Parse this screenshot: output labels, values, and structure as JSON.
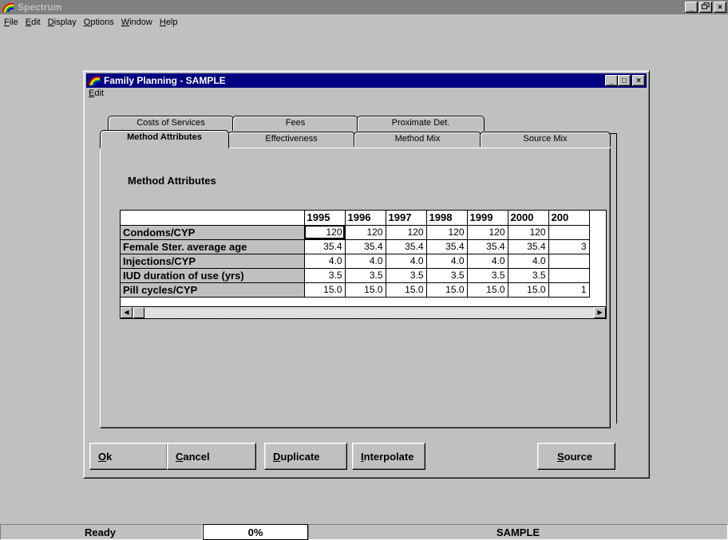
{
  "app": {
    "title": "Spectrum",
    "menu": [
      {
        "label": "File",
        "key": "F"
      },
      {
        "label": "Edit",
        "key": "E"
      },
      {
        "label": "Display",
        "key": "D"
      },
      {
        "label": "Options",
        "key": "O"
      },
      {
        "label": "Window",
        "key": "W"
      },
      {
        "label": "Help",
        "key": "H"
      }
    ],
    "controls": {
      "minimize": "_",
      "restore": "ř",
      "close": "×"
    }
  },
  "child": {
    "title": "Family Planning - SAMPLE",
    "menu": [
      "Edit"
    ],
    "controls": {
      "minimize": "_",
      "maximize": "□",
      "close": "×"
    }
  },
  "tabs": {
    "back_row": [
      "Costs of Services",
      "Fees",
      "Proximate Det."
    ],
    "front_row": [
      "Method Attributes",
      "Effectiveness",
      "Method Mix",
      "Source Mix"
    ],
    "active": "Method Attributes"
  },
  "panel": {
    "section_title": "Method Attributes",
    "grid": {
      "columns": [
        "1995",
        "1996",
        "1997",
        "1998",
        "1999",
        "2000",
        "200"
      ],
      "rows": [
        {
          "label": "Condoms/CYP",
          "values": [
            "120",
            "120",
            "120",
            "120",
            "120",
            "120",
            ""
          ]
        },
        {
          "label": "Female Ster. average age",
          "values": [
            "35.4",
            "35.4",
            "35.4",
            "35.4",
            "35.4",
            "35.4",
            "3"
          ]
        },
        {
          "label": "Injections/CYP",
          "values": [
            "4.0",
            "4.0",
            "4.0",
            "4.0",
            "4.0",
            "4.0",
            ""
          ]
        },
        {
          "label": "IUD duration of use (yrs)",
          "values": [
            "3.5",
            "3.5",
            "3.5",
            "3.5",
            "3.5",
            "3.5",
            ""
          ]
        },
        {
          "label": "Pill cycles/CYP",
          "values": [
            "15.0",
            "15.0",
            "15.0",
            "15.0",
            "15.0",
            "15.0",
            "1"
          ]
        }
      ],
      "selected_cell": "Condoms/CYP 1995"
    }
  },
  "buttons": {
    "ok": {
      "label": "Ok",
      "key": "O",
      "rest": "k"
    },
    "cancel": {
      "label": "Cancel",
      "key": "C",
      "rest": "ancel"
    },
    "duplicate": {
      "label": "Duplicate",
      "key": "D",
      "rest": "uplicate"
    },
    "interpolate": {
      "label": "Interpolate",
      "key": "I",
      "rest": "nterpolate"
    },
    "source": {
      "label": "Source",
      "key": "S",
      "rest": "ource"
    }
  },
  "status": {
    "state": "Ready",
    "progress": "0%",
    "projection": "SAMPLE"
  },
  "colors": {
    "active_title": "#000080",
    "inactive_title": "#808080",
    "face": "#c0c0c0"
  }
}
